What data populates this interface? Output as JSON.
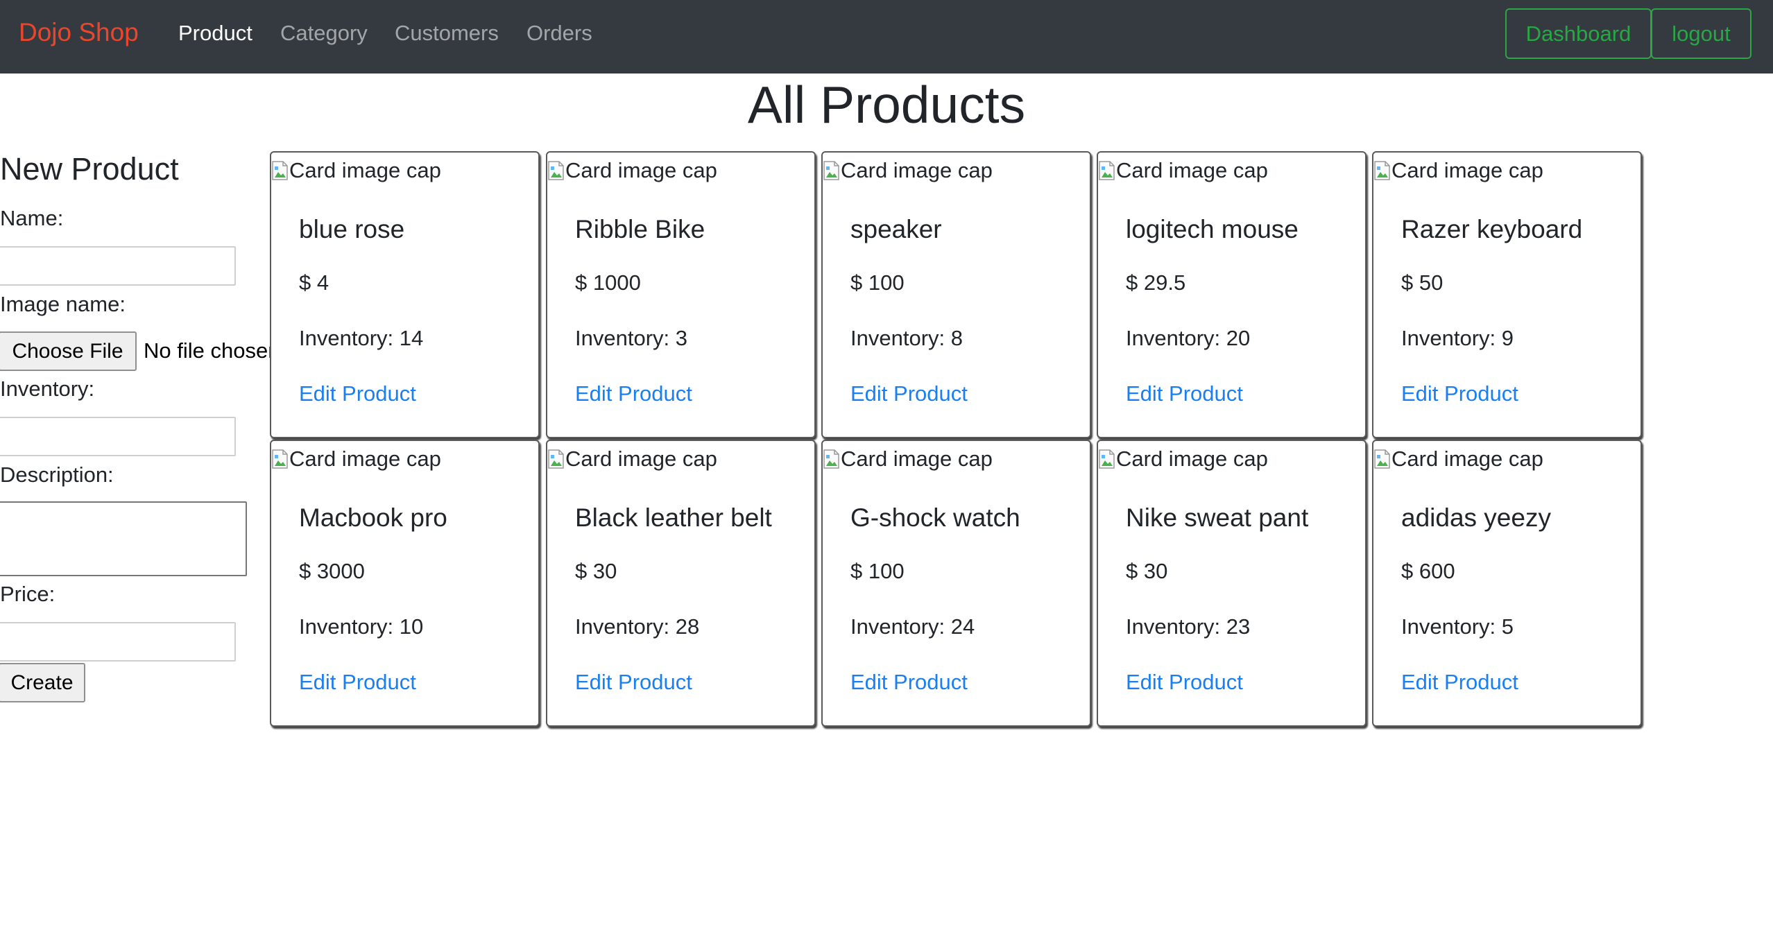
{
  "nav": {
    "brand": "Dojo Shop",
    "links": [
      "Product",
      "Category",
      "Customers",
      "Orders"
    ],
    "active": "Product",
    "dashboard_label": "Dashboard",
    "logout_label": "logout",
    "brand_color": "#e8472d",
    "accent_color": "#28a745",
    "background": "#343a40"
  },
  "page": {
    "title": "All Products"
  },
  "form": {
    "title": "New Product",
    "name_label": "Name:",
    "name_value": "",
    "image_label": "Image name:",
    "file_button": "Choose File",
    "file_status": "No file chosen",
    "inventory_label": "Inventory:",
    "inventory_value": "",
    "description_label": "Description:",
    "description_value": "",
    "price_label": "Price:",
    "price_value": "",
    "submit_label": "Create"
  },
  "card_common": {
    "image_alt": "Card image cap",
    "price_prefix": "$",
    "inventory_prefix": "Inventory:",
    "edit_label": "Edit Product",
    "link_color": "#1a7ff0"
  },
  "products": [
    {
      "name": "blue rose",
      "price": "$ 4",
      "inventory": "Inventory: 14",
      "edit": "Edit Product",
      "image_alt": "Card image cap"
    },
    {
      "name": "Ribble Bike",
      "price": "$ 1000",
      "inventory": "Inventory: 3",
      "edit": "Edit Product",
      "image_alt": "Card image cap"
    },
    {
      "name": "speaker",
      "price": "$ 100",
      "inventory": "Inventory: 8",
      "edit": "Edit Product",
      "image_alt": "Card image cap"
    },
    {
      "name": "logitech mouse",
      "price": "$ 29.5",
      "inventory": "Inventory: 20",
      "edit": "Edit Product",
      "image_alt": "Card image cap"
    },
    {
      "name": "Razer keyboard",
      "price": "$ 50",
      "inventory": "Inventory: 9",
      "edit": "Edit Product",
      "image_alt": "Card image cap"
    },
    {
      "name": "Macbook pro",
      "price": "$ 3000",
      "inventory": "Inventory: 10",
      "edit": "Edit Product",
      "image_alt": "Card image cap"
    },
    {
      "name": "Black leather belt",
      "price": "$ 30",
      "inventory": "Inventory: 28",
      "edit": "Edit Product",
      "image_alt": "Card image cap"
    },
    {
      "name": "G-shock watch",
      "price": "$ 100",
      "inventory": "Inventory: 24",
      "edit": "Edit Product",
      "image_alt": "Card image cap"
    },
    {
      "name": "Nike sweat pant",
      "price": "$ 30",
      "inventory": "Inventory: 23",
      "edit": "Edit Product",
      "image_alt": "Card image cap"
    },
    {
      "name": "adidas yeezy",
      "price": "$ 600",
      "inventory": "Inventory: 5",
      "edit": "Edit Product",
      "image_alt": "Card image cap"
    }
  ]
}
